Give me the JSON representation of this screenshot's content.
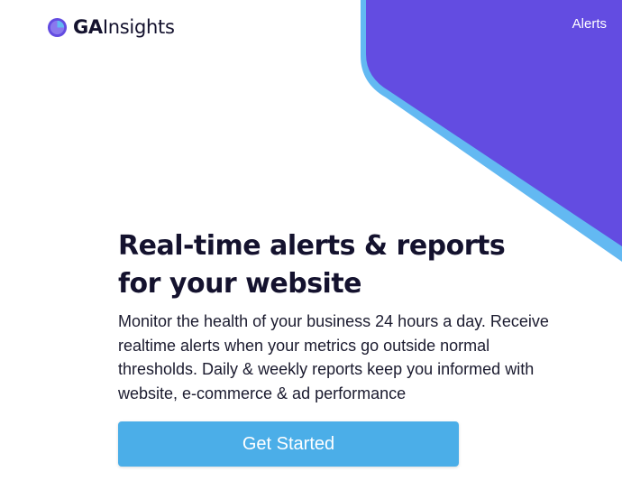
{
  "brand": {
    "name_bold": "GA",
    "name_light": "Insights",
    "logo_icon": "pie-chart-icon",
    "colors": {
      "primary_purple": "#634ce1",
      "accent_blue": "#63b9f2",
      "button_blue": "#4baee8",
      "text_dark": "#14122e"
    }
  },
  "nav": {
    "alerts_label": "Alerts"
  },
  "hero": {
    "headline": "Real-time alerts & reports for your website",
    "description": "Monitor the health of your business 24 hours a day. Receive realtime alerts when your metrics go outside normal thresholds. Daily & weekly reports keep you informed with website, e-commerce & ad performance",
    "cta_label": "Get Started"
  }
}
